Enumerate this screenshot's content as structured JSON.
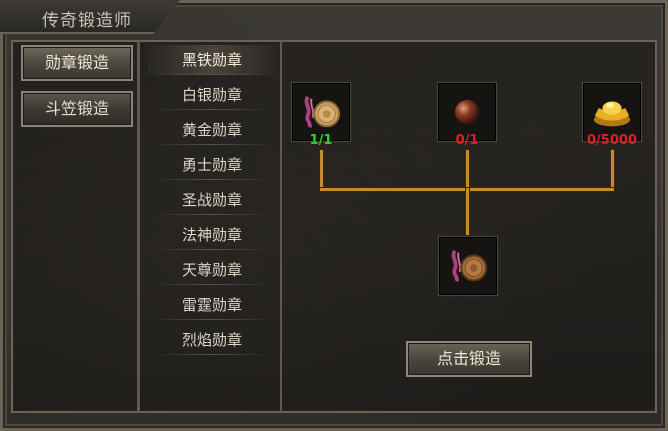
{
  "window": {
    "title": "传奇锻造师"
  },
  "categories": [
    {
      "label": "勋章锻造",
      "active": true
    },
    {
      "label": "斗笠锻造",
      "active": false
    }
  ],
  "items": [
    {
      "label": "黑铁勋章",
      "selected": true
    },
    {
      "label": "白银勋章"
    },
    {
      "label": "黄金勋章"
    },
    {
      "label": "勇士勋章"
    },
    {
      "label": "圣战勋章"
    },
    {
      "label": "法神勋章"
    },
    {
      "label": "天尊勋章"
    },
    {
      "label": "雷霆勋章"
    },
    {
      "label": "烈焰勋章"
    }
  ],
  "materials": [
    {
      "icon": "medal-icon",
      "count": "1/1",
      "color": "#28d628"
    },
    {
      "icon": "bead-icon",
      "count": "0/1",
      "color": "#e02020"
    },
    {
      "icon": "gold-ingot-icon",
      "count": "0/5000",
      "color": "#e02020"
    }
  ],
  "result": {
    "icon": "medal-icon"
  },
  "forge_button": {
    "label": "点击锻造"
  },
  "colors": {
    "connector": "#c78a2d",
    "ok": "#28d628",
    "missing": "#e02020"
  }
}
